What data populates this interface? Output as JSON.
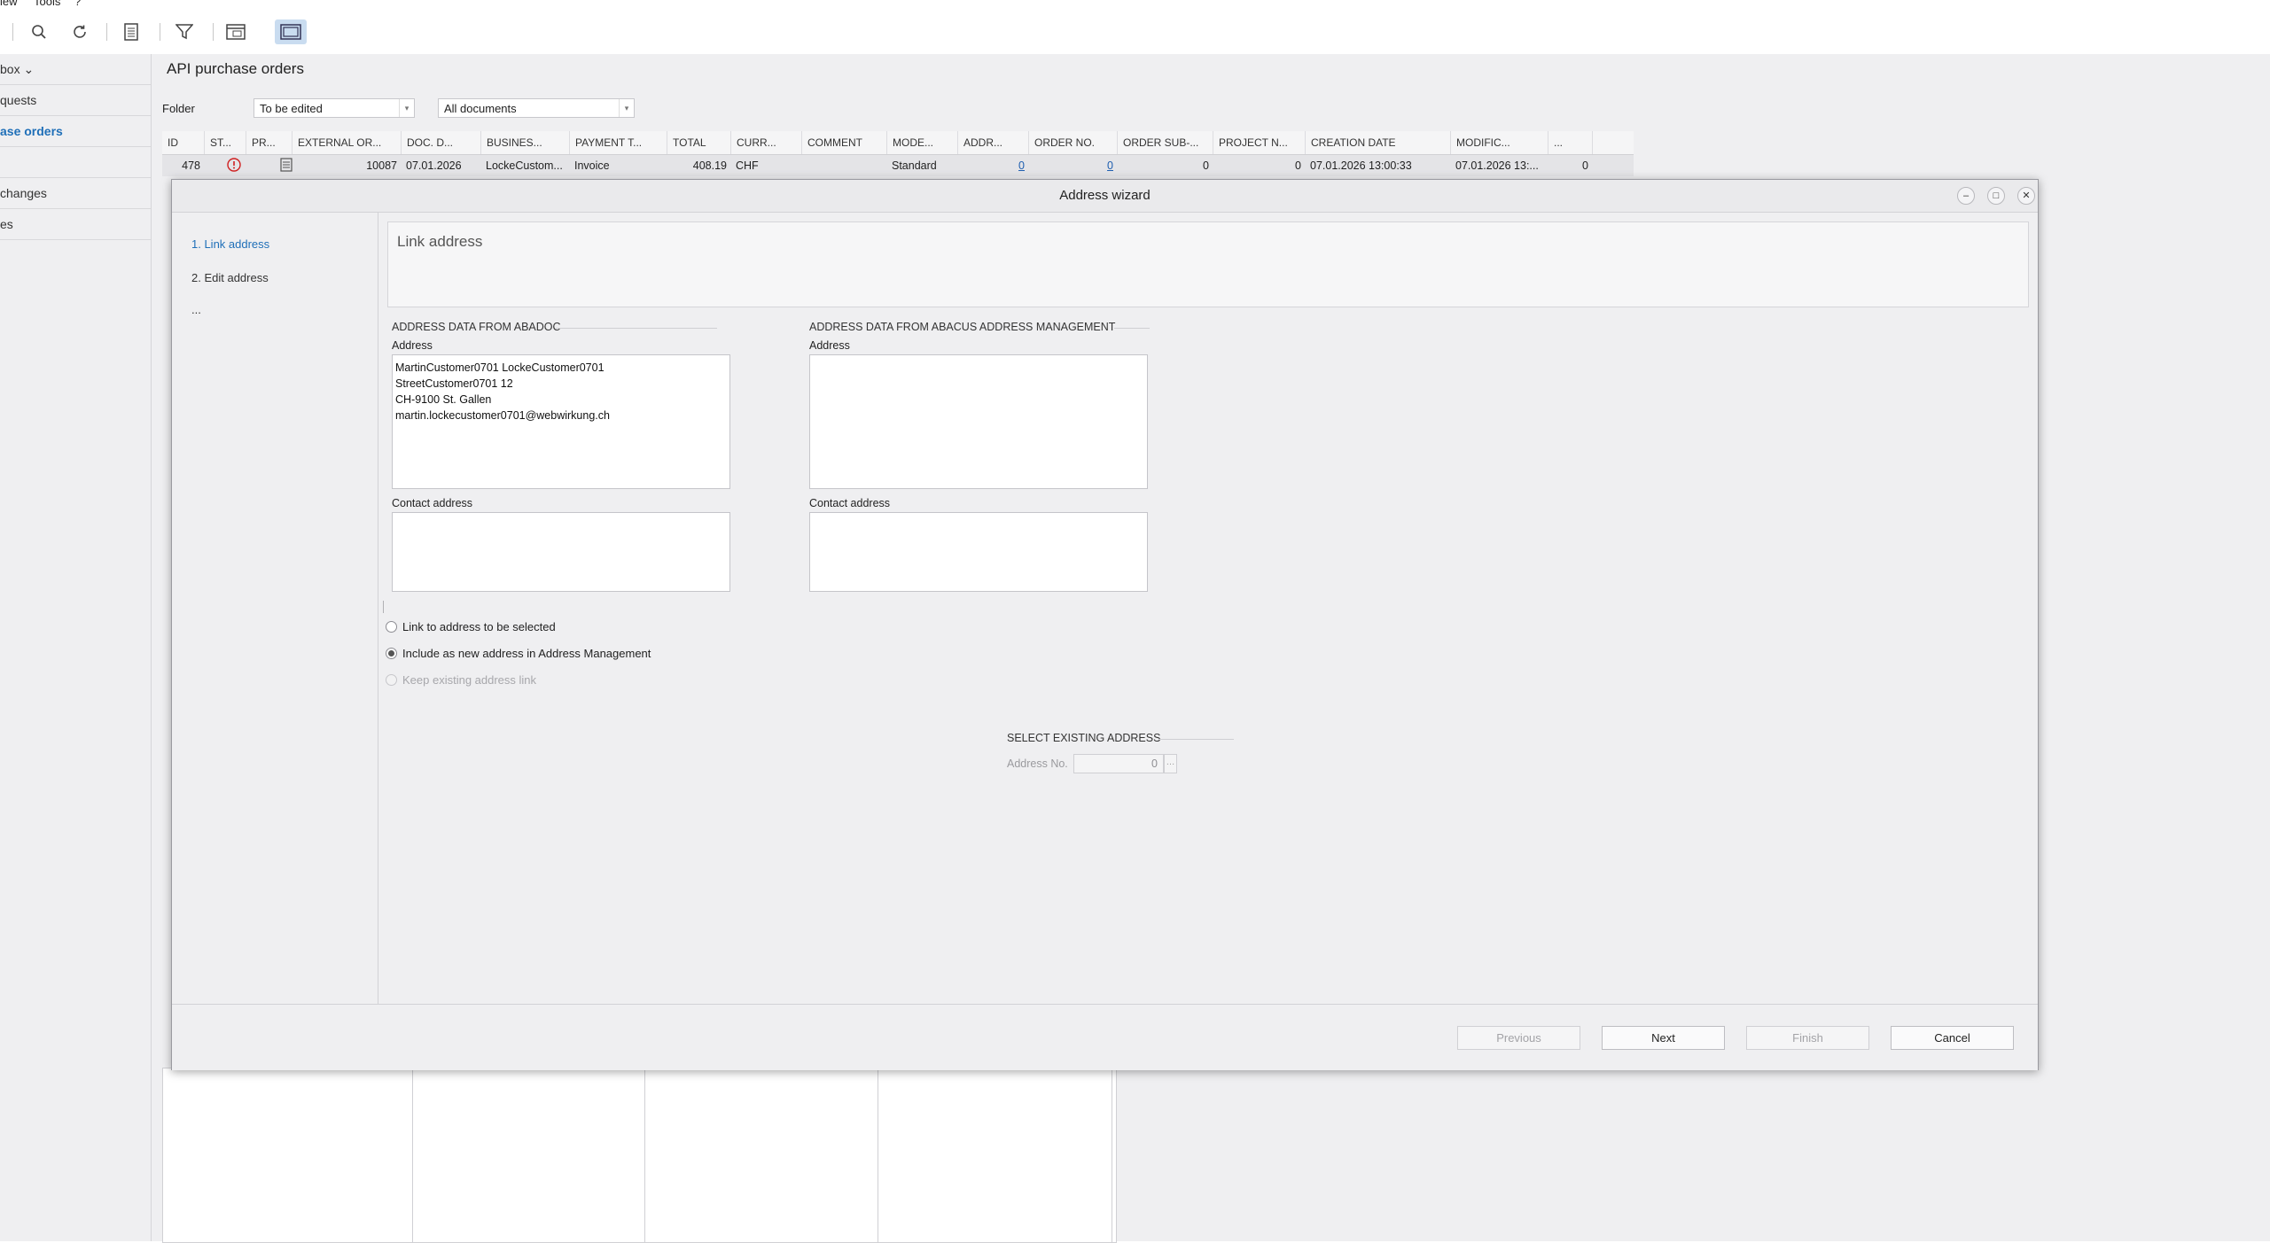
{
  "menubar": {
    "view": "iew",
    "tools": "Tools",
    "extra": "?"
  },
  "toolbar": {
    "icons": [
      "search-icon",
      "refresh-icon",
      "document-icon",
      "filter-icon",
      "window-icon",
      "panels-icon"
    ]
  },
  "leftnav": {
    "items": [
      {
        "label": "box ⌄"
      },
      {
        "label": "quests"
      },
      {
        "label": "ase orders"
      },
      {
        "label": ""
      },
      {
        "label": "changes"
      },
      {
        "label": "es"
      }
    ]
  },
  "main": {
    "title": "API purchase orders",
    "folder_label": "Folder",
    "folder_value": "To be edited",
    "docs_value": "All documents",
    "columns": [
      "ID",
      "ST...",
      "PR...",
      "EXTERNAL OR...",
      "DOC. D...",
      "BUSINES...",
      "PAYMENT T...",
      "TOTAL",
      "CURR...",
      "COMMENT",
      "MODE...",
      "ADDR...",
      "ORDER NO.",
      "ORDER SUB-...",
      "PROJECT N...",
      "CREATION DATE",
      "MODIFIC...",
      "..."
    ],
    "row": {
      "id": "478",
      "external": "10087",
      "doc_date": "07.01.2026",
      "business": "LockeCustom...",
      "payment": "Invoice",
      "total": "408.19",
      "currency": "CHF",
      "comment": "",
      "mode": "Standard",
      "addr": "0",
      "order_no": "0",
      "order_sub": "0",
      "project": "0",
      "creation": "07.01.2026 13:00:33",
      "modified": "07.01.2026 13:...",
      "last": "0"
    }
  },
  "dialog": {
    "title": "Address wizard",
    "steps": [
      "1. Link address",
      "2. Edit address",
      "..."
    ],
    "header": "Link address",
    "left_section": "ADDRESS DATA FROM ABADOC",
    "right_section": "ADDRESS DATA FROM ABACUS ADDRESS MANAGEMENT",
    "address_label": "Address",
    "contact_label": "Contact address",
    "address_lines": [
      "MartinCustomer0701 LockeCustomer0701",
      "StreetCustomer0701 12",
      "CH-9100 St. Gallen",
      "martin.lockecustomer0701@webwirkung.ch"
    ],
    "options": [
      {
        "label": "Link to address to be selected",
        "checked": false,
        "disabled": false
      },
      {
        "label": "Include as new address in Address Management",
        "checked": true,
        "disabled": false
      },
      {
        "label": "Keep existing address link",
        "checked": false,
        "disabled": true
      }
    ],
    "select_section": "SELECT EXISTING ADDRESS",
    "address_no_label": "Address No.",
    "address_no_value": "0",
    "buttons": {
      "previous": "Previous",
      "next": "Next",
      "finish": "Finish",
      "cancel": "Cancel"
    }
  }
}
